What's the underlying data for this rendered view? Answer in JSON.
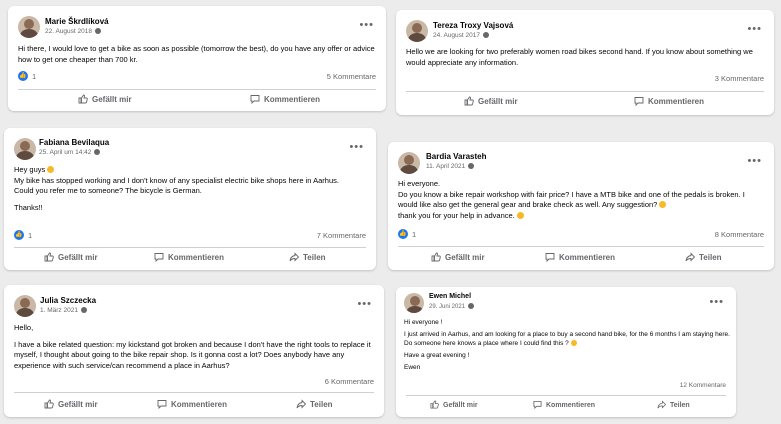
{
  "posts": [
    {
      "author": "Marie Škrdlíková",
      "date": "22. August 2018",
      "text": "Hi there, I would love to get a bike as soon as possible (tomorrow the best), do you have any offer or advice how to get one cheaper than 700 kr.",
      "likes": "1",
      "comments": "5 Kommentare",
      "actions": [
        "Gefällt mir",
        "Kommentieren"
      ]
    },
    {
      "author": "Tereza Troxy Vajsová",
      "date": "24. August 2017",
      "text": "Hello we are looking for two preferably women road bikes second hand. If you know about something we would appreciate any information.",
      "comments": "3 Kommentare",
      "actions": [
        "Gefällt mir",
        "Kommentieren"
      ]
    },
    {
      "author": "Fabiana Bevilaqua",
      "date": "25. April um 14:42",
      "lines": [
        "Hey guys",
        "My bike has stopped working and I don't know of any specialist electric bike shops here in Aarhus.",
        "Could you refer me to someone? The bicycle is German.",
        "",
        "Thanks!!"
      ],
      "likes": "1",
      "comments": "7 Kommentare",
      "actions": [
        "Gefällt mir",
        "Kommentieren",
        "Teilen"
      ]
    },
    {
      "author": "Bardia Varasteh",
      "date": "11. April 2021",
      "lines": [
        "Hi everyone.",
        "Do you know a bike repair workshop with fair price? I have a MTB bike and one of the pedals is broken. I would like also get the general gear and brake  check as well. Any suggestion?",
        "thank you for your help in advance."
      ],
      "likes": "1",
      "comments": "8 Kommentare",
      "actions": [
        "Gefällt mir",
        "Kommentieren",
        "Teilen"
      ]
    },
    {
      "author": "Julia Szczecka",
      "date": "1. März 2021",
      "lines": [
        "Hello,",
        "",
        "I have a bike related question: my kickstand got broken and because I don't have the right tools to replace it myself, I thought about going to the bike repair shop. Is it gonna cost a lot? Does anybody have any experience with such service/can recommend a place in Aarhus?"
      ],
      "comments": "6 Kommentare",
      "actions": [
        "Gefällt mir",
        "Kommentieren",
        "Teilen"
      ]
    },
    {
      "author": "Ewen Michel",
      "date": "29. Juni 2021",
      "lines": [
        "Hi everyone !",
        "I just arrived in Aarhus, and am looking for a place to buy a second hand bike, for the 6 months I am staying here. Do someone here knows a place where I could find this ?",
        "Have a great evening !",
        "Ewen"
      ],
      "comments": "12 Kommentare",
      "actions": [
        "Gefällt mir",
        "Kommentieren",
        "Teilen"
      ]
    }
  ],
  "colors": {
    "accent": "#1877f2",
    "muted": "#65676b",
    "divider": "#ced0d4"
  },
  "icons": [
    "like-icon",
    "comment-icon",
    "share-icon",
    "globe-icon",
    "more-icon"
  ]
}
